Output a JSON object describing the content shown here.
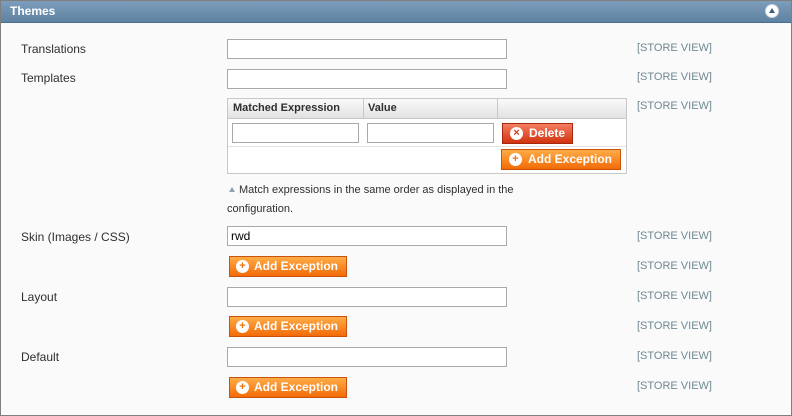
{
  "section": {
    "title": "Themes",
    "collapse_icon": "collapse-up-icon"
  },
  "rows": {
    "translations": {
      "label": "Translations",
      "value": "",
      "scope": "[STORE VIEW]"
    },
    "templates": {
      "label": "Templates",
      "value": "",
      "scope": "[STORE VIEW]"
    },
    "templates_exceptions": {
      "scope": "[STORE VIEW]",
      "columns": [
        "Matched Expression",
        "Value"
      ],
      "rows": [
        {
          "expression": "",
          "value": "",
          "delete_label": "Delete"
        }
      ],
      "add_label": "Add Exception",
      "note": "Match expressions in the same order as displayed in the configuration."
    },
    "skin": {
      "label": "Skin (Images / CSS)",
      "value": "rwd",
      "scope": "[STORE VIEW]",
      "add_label": "Add Exception",
      "add_scope": "[STORE VIEW]"
    },
    "layout": {
      "label": "Layout",
      "value": "",
      "scope": "[STORE VIEW]",
      "add_label": "Add Exception",
      "add_scope": "[STORE VIEW]"
    },
    "default": {
      "label": "Default",
      "value": "",
      "scope": "[STORE VIEW]",
      "add_label": "Add Exception",
      "add_scope": "[STORE VIEW]"
    }
  },
  "colors": {
    "header": "#6a8cab",
    "button_orange": "#f77c16",
    "button_red": "#dc3d1b",
    "scope_text": "#6f8992"
  }
}
